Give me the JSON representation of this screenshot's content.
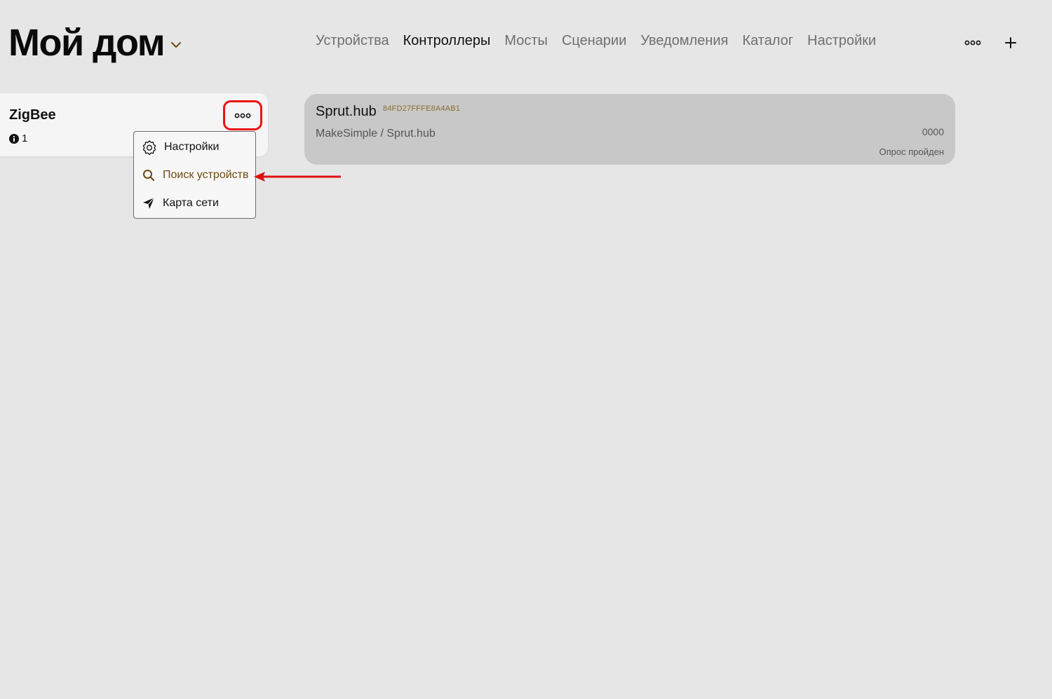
{
  "header": {
    "home_title": "Мой дом",
    "nav_tabs": [
      {
        "label": "Устройства",
        "active": false
      },
      {
        "label": "Контроллеры",
        "active": true
      },
      {
        "label": "Мосты",
        "active": false
      },
      {
        "label": "Сценарии",
        "active": false
      },
      {
        "label": "Уведомления",
        "active": false
      },
      {
        "label": "Каталог",
        "active": false
      },
      {
        "label": "Настройки",
        "active": false
      }
    ],
    "actions": [
      "more-icon",
      "plus-icon"
    ]
  },
  "controller": {
    "name": "ZigBee",
    "info_count": "1",
    "more_button_highlighted": true
  },
  "context_menu": {
    "items": [
      {
        "label": "Настройки",
        "icon": "gear-icon"
      },
      {
        "label": "Поиск устройств",
        "icon": "search-icon",
        "highlighted": true
      },
      {
        "label": "Карта сети",
        "icon": "network-map-icon"
      }
    ]
  },
  "bridge": {
    "title": "Sprut.hub",
    "id": "84FD27FFFE8A4AB1",
    "vendor": "MakeSimple / Sprut.hub",
    "code": "0000",
    "status": "Опрос пройден"
  },
  "colors": {
    "background": "#e6e6e6",
    "highlight_red": "#ee1111",
    "accent_brown": "#6e4a0e",
    "id_gold": "#8a6d2e"
  }
}
